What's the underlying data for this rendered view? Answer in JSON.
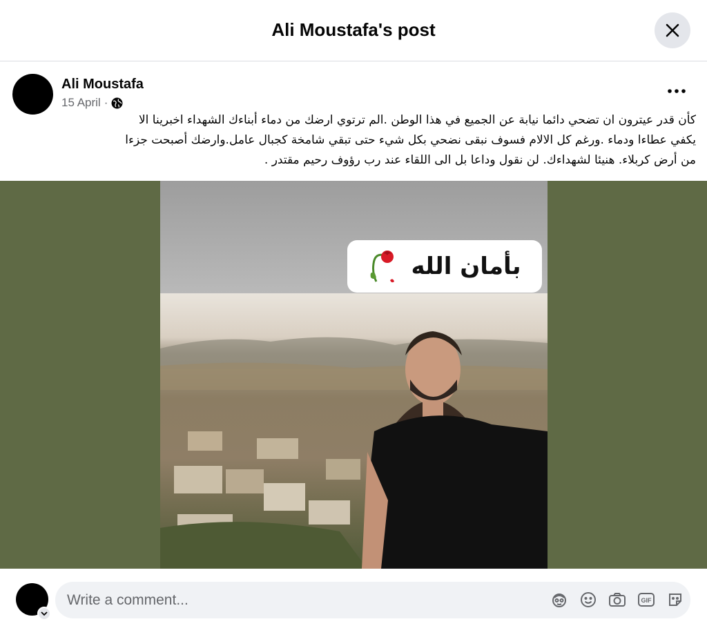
{
  "header": {
    "title": "Ali Moustafa's post"
  },
  "post": {
    "author": "Ali Moustafa",
    "date": "15 April",
    "separator": "·",
    "text_lines": [
      "كأن قدر عيترون ان تضحي دائما نيابة عن الجميع في هذا الوطن .الم ترتوي ارضك من دماء أبناءك الشهداء اخبرينا الا",
      "يكفي  عطاءا ودماء .ورغم كل الالام فسوف نبقى نضحي بكل شيء حتى تبقي شامخة كجبال عامل.وارضك أصبحت جزءا",
      "من أرض كربلاء. هنيئا لشهداءك. لن نقول وداعا بل الى اللقاء عند رب رؤوف رحيم مقتدر ."
    ],
    "image_sticker_text": "بأمان الله"
  },
  "comment": {
    "placeholder": "Write a comment..."
  },
  "colors": {
    "media_background": "#5f6a45",
    "close_button_bg": "#e4e6eb",
    "comment_bg": "#f0f2f5"
  },
  "icons": {
    "close": "close-icon",
    "more": "more-options-icon",
    "privacy": "globe-icon",
    "comment_tools": [
      "avatar-sticker-icon",
      "emoji-icon",
      "camera-icon",
      "gif-icon",
      "sticker-icon"
    ]
  }
}
